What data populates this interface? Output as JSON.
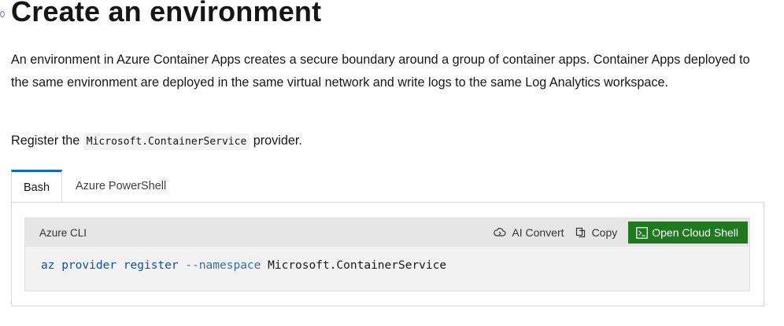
{
  "article": {
    "title": "Create an environment",
    "description": "An environment in Azure Container Apps creates a secure boundary around a group of container apps. Container Apps deployed to the same environment are deployed in the same virtual network and write logs to the same Log Analytics workspace.",
    "register_prefix": "Register the ",
    "register_code": "Microsoft.ContainerService",
    "register_suffix": " provider."
  },
  "tabs": [
    {
      "label": "Bash",
      "active": true
    },
    {
      "label": "Azure PowerShell",
      "active": false
    }
  ],
  "code_block": {
    "language": "Azure CLI",
    "ai_convert_label": "AI Convert",
    "copy_label": "Copy",
    "cloud_shell_label": "Open Cloud Shell",
    "command": {
      "cmd": "az",
      "sub1": "provider",
      "sub2": "register",
      "flag": "--namespace",
      "value": "Microsoft.ContainerService"
    }
  },
  "colors": {
    "tab_accent": "#0f6cbd",
    "cloud_shell_bg": "#1f7a1f",
    "code_keyword": "#0b4fb3"
  }
}
